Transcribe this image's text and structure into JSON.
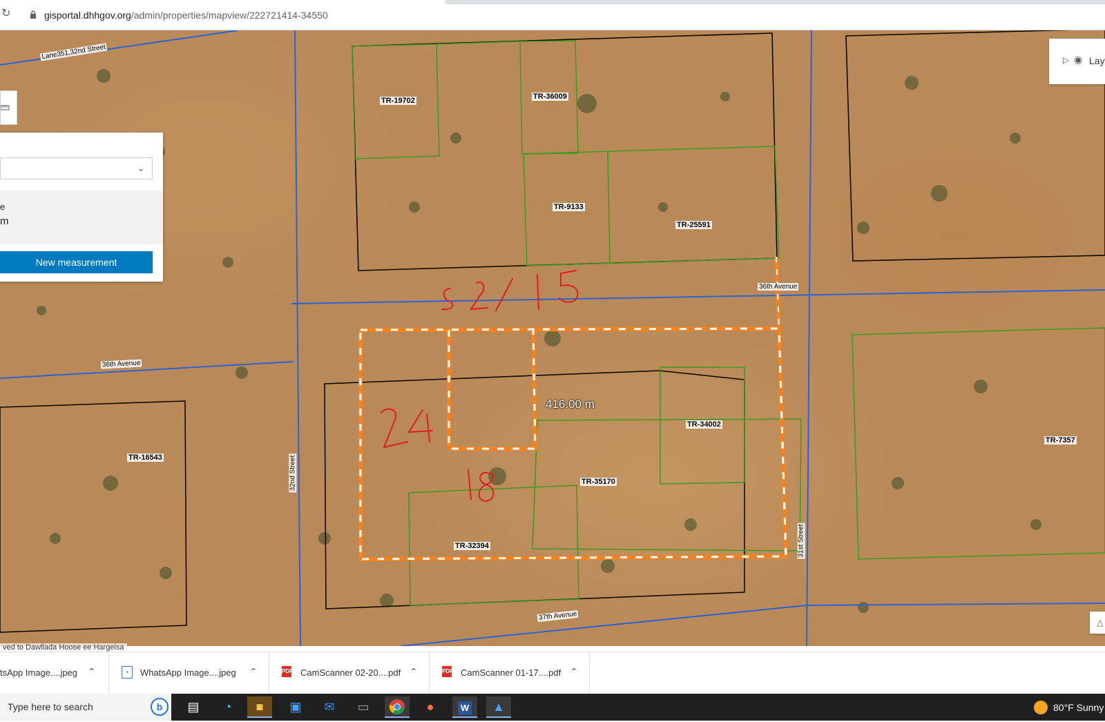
{
  "browser": {
    "url_host": "gisportal.dhhgov.org",
    "url_path": "/admin/properties/mapview/222721414-34550",
    "reload_icon": "reload-icon",
    "lock_icon": "lock-icon"
  },
  "map": {
    "parcels": [
      {
        "id": "TR-19702"
      },
      {
        "id": "TR-36009"
      },
      {
        "id": "TR-9133"
      },
      {
        "id": "TR-25591"
      },
      {
        "id": "TR-16543"
      },
      {
        "id": "TR-34002"
      },
      {
        "id": "TR-35170"
      },
      {
        "id": "TR-32394"
      },
      {
        "id": "TR-7357"
      }
    ],
    "streets": [
      "Lane351,32nd Street",
      "36th Avenue",
      "36th Avenue",
      "32nd Street",
      "31st Street",
      "37th Avenue"
    ],
    "measurement_label": "416.00 m",
    "handwritten_annotations": [
      "52/15",
      "24",
      "18"
    ],
    "attribution": "ved to Dawllada Hoose ee Hargeisa"
  },
  "measure_panel": {
    "unit_selected": "",
    "result_label": "e",
    "result_value": "m",
    "new_button": "New measurement"
  },
  "layers": {
    "label": "Lay"
  },
  "downloads": [
    {
      "name": "tsApp Image....jpeg",
      "type": "image"
    },
    {
      "name": "WhatsApp Image....jpeg",
      "type": "image"
    },
    {
      "name": "CamScanner 02-20....pdf",
      "type": "pdf"
    },
    {
      "name": "CamScanner 01-17....pdf",
      "type": "pdf"
    }
  ],
  "taskbar": {
    "search_placeholder": "Type here to search",
    "weather_temp": "80°F",
    "weather_cond": "Sunny",
    "apps": [
      "task-view",
      "edge",
      "file-explorer",
      "microsoft-store",
      "mail",
      "app-unknown",
      "chrome",
      "firefox",
      "word",
      "photos"
    ]
  }
}
